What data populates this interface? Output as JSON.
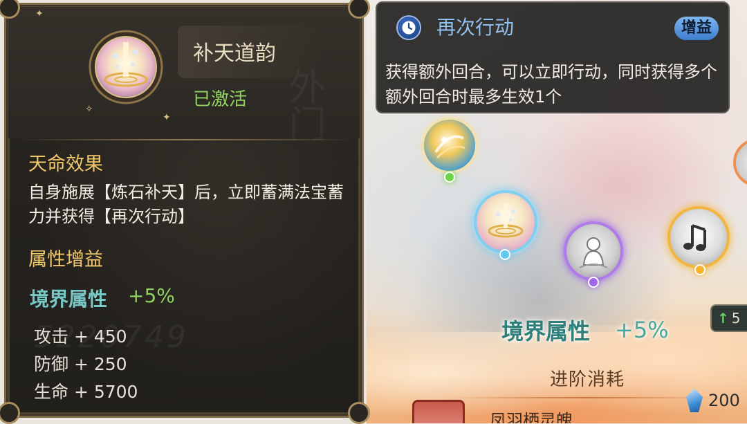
{
  "skill_panel": {
    "name": "补天道韵",
    "status": "已激活",
    "destiny_title": "天命效果",
    "destiny_desc": "自身施展【炼石补天】后，立即蓄满法宝蓄力并获得【再次行动】",
    "attr_title": "属性增益",
    "realm_label": "境界属性",
    "realm_value": "+5%",
    "attributes": [
      {
        "label": "攻击 + 450"
      },
      {
        "label": "防御 + 250"
      },
      {
        "label": "生命 + 5700"
      }
    ],
    "watermark": "5220749"
  },
  "buff_tooltip": {
    "title": "再次行动",
    "tag": "增益",
    "description": "获得额外回合，可以立即行动，同时获得多个额外回合时最多生效1个",
    "icon": "clock-icon"
  },
  "scene": {
    "stat_label": "境界属性",
    "stat_value": "+5%",
    "advance_title": "进阶消耗",
    "material_name": "凤羽栖灵魄",
    "cost_value": "200",
    "side_badge": "5",
    "nodes": [
      {
        "name": "node-sunburst",
        "icon": "sun-swirl-icon",
        "dot_color": "#6fd34a"
      },
      {
        "name": "node-butian",
        "icon": "mending-heaven-icon",
        "dot_color": "#63c9ef"
      },
      {
        "name": "node-spirit",
        "icon": "spirit-figure-icon",
        "dot_color": "#a066e8"
      },
      {
        "name": "node-music",
        "icon": "music-note-icon",
        "dot_color": "#f5b430"
      }
    ]
  },
  "colors": {
    "panel_bg": "#26231f",
    "panel_border": "#7b6747",
    "gold_title": "#f2c86c",
    "green_active": "#8fd35e",
    "teal_realm": "#78c9c5",
    "buff_blue": "#8fc0f0"
  }
}
